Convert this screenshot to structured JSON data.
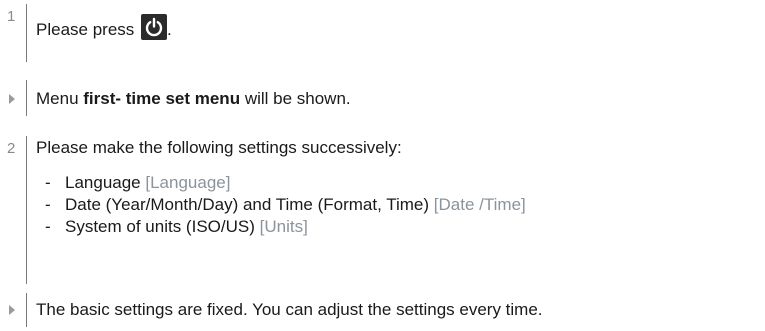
{
  "steps": [
    {
      "marker": "1",
      "text_before": "Please press",
      "icon": "power-icon",
      "text_after": "."
    },
    {
      "marker_icon": "result-triangle-icon",
      "text_before": "Menu",
      "bold": "first- time set menu",
      "text_after": "will be shown."
    },
    {
      "marker": "2",
      "text": "Please make the following settings successively:",
      "items": [
        {
          "dash": "-",
          "text": "Language",
          "ref": "[Language]"
        },
        {
          "dash": "-",
          "text": "Date (Year/Month/Day) and Time (Format, Time)",
          "ref": "[Date /Time]"
        },
        {
          "dash": "-",
          "text": "System of units (ISO/US)",
          "ref": "[Units]"
        }
      ]
    },
    {
      "marker_icon": "result-triangle-icon",
      "text": "The basic settings are fixed. You can adjust the settings every time."
    }
  ],
  "colors": {
    "text": "#1a1a1a",
    "reference": "#8a949c",
    "marker": "#8a8a8a",
    "rule": "#7a7a7a",
    "icon_bg": "#2b2b2b"
  }
}
